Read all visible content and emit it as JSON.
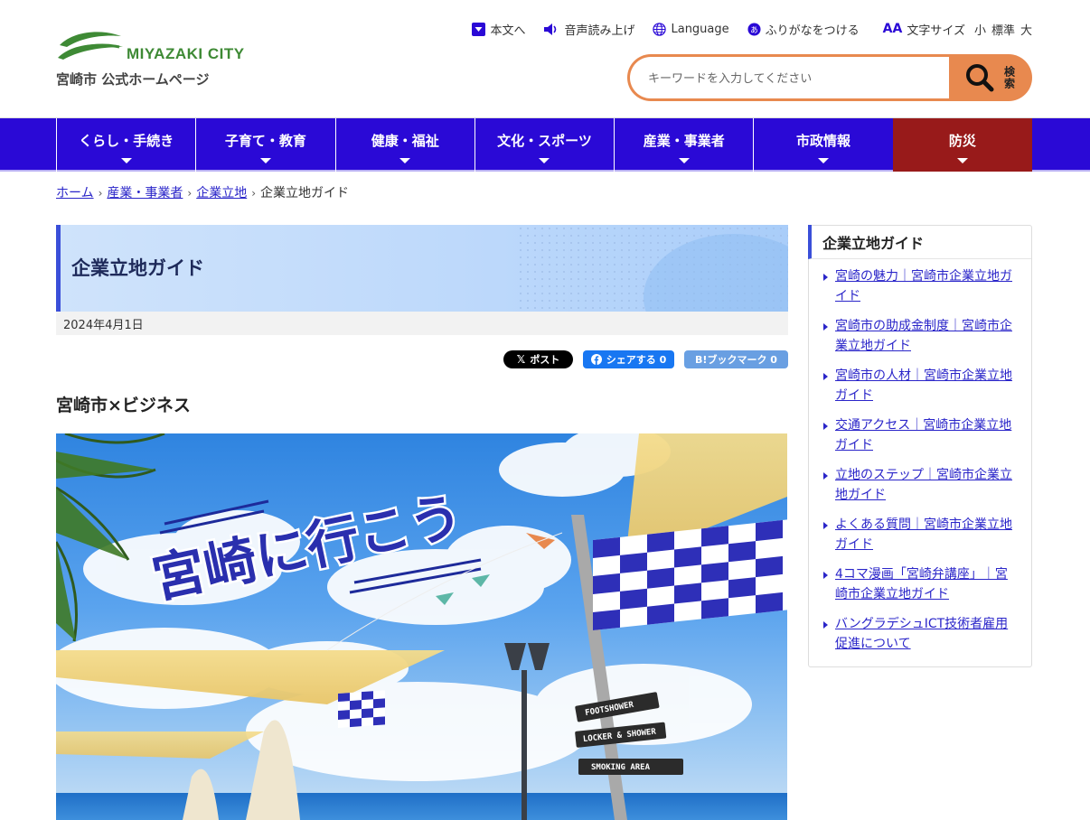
{
  "header": {
    "logo_text": "MIYAZAKI CITY",
    "site_name": "宮崎市 公式ホームページ",
    "utility": {
      "skip_label": "本文へ",
      "read_aloud_label": "音声読み上げ",
      "language_label": "Language",
      "furigana_label": "ふりがなをつける",
      "font_size_label": "文字サイズ",
      "font_small": "小",
      "font_standard": "標準",
      "font_large": "大",
      "font_size_icon": "AA"
    },
    "search": {
      "placeholder": "キーワードを入力してください",
      "button_label": "検索"
    }
  },
  "nav": {
    "items": [
      {
        "label": "くらし・手続き"
      },
      {
        "label": "子育て・教育"
      },
      {
        "label": "健康・福祉"
      },
      {
        "label": "文化・スポーツ"
      },
      {
        "label": "産業・事業者"
      },
      {
        "label": "市政情報"
      },
      {
        "label": "防災"
      }
    ]
  },
  "breadcrumb": {
    "items": [
      "ホーム",
      "産業・事業者",
      "企業立地"
    ],
    "current": "企業立地ガイド"
  },
  "main": {
    "title": "企業立地ガイド",
    "date": "2024年4月1日",
    "share": {
      "x_label": "ポスト",
      "fb_label": "シェアする 0",
      "hb_label": "B!ブックマーク  0"
    },
    "section_heading": "宮崎市×ビジネス",
    "hero_caption": "宮崎に行こう",
    "sign_labels": [
      "FOOTSHOWER",
      "LOCKER & SHOWER",
      "SMOKING AREA"
    ]
  },
  "sidebar": {
    "title": "企業立地ガイド",
    "links": [
      "宮崎の魅力｜宮崎市企業立地ガイド",
      "宮崎市の助成金制度｜宮崎市企業立地ガイド",
      "宮崎市の人材｜宮崎市企業立地ガイド",
      "交通アクセス｜宮崎市企業立地ガイド",
      "立地のステップ｜宮崎市企業立地ガイド",
      "よくある質問｜宮崎市企業立地ガイド",
      "4コマ漫画「宮崎弁講座」｜宮崎市企業立地ガイド",
      "バングラデシュICT技術者雇用促進について"
    ]
  },
  "colors": {
    "nav_bg": "#2a09d6",
    "disaster_bg": "#981a1a",
    "search_accent": "#e8894f",
    "link": "#2a25c9",
    "logo_green": "#3e8a35"
  }
}
